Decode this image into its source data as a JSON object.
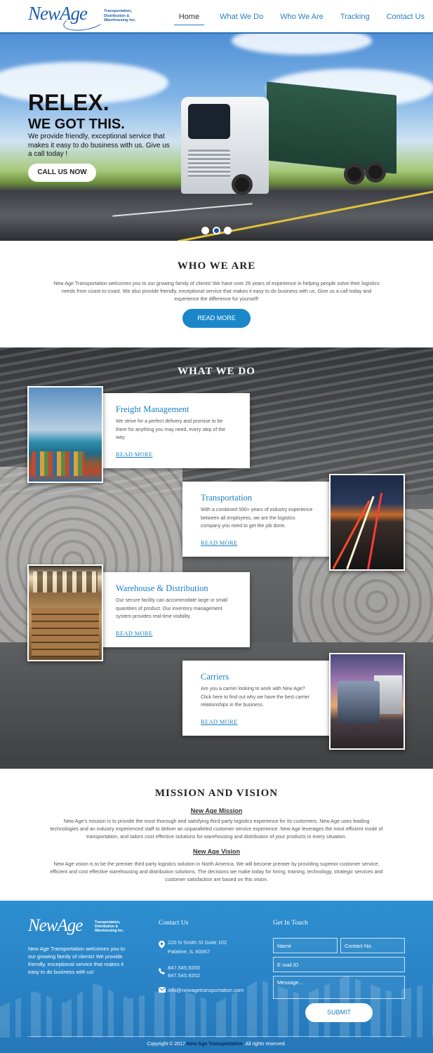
{
  "header": {
    "logo_word": "NewAge",
    "logo_tagline": "Transportation, Distribution & Warehousing Inc.",
    "nav": [
      "Home",
      "What We Do",
      "Who We Are",
      "Tracking",
      "Contact Us"
    ],
    "active_nav": "Home"
  },
  "hero": {
    "title": "RELEX.",
    "subtitle": "WE GOT THIS.",
    "text": "We provide friendly, exceptional service that makes it easy to do business with us. Give us a call today !",
    "button": "CALL US NOW",
    "slides": 3,
    "active_slide": 2
  },
  "who": {
    "title": "WHO WE ARE",
    "text": "New Age Transportation welcomes you to our growing family of clients! We have over 26 years of experience in helping people solve their logistics needs from coast-to-coast. We also provide friendly, exceptional service that makes it easy to do business with us. Give us a call today and experience the difference for yourself!",
    "button": "READ MORE"
  },
  "what": {
    "title": "WHAT WE DO",
    "cards": [
      {
        "title": "Freight Management",
        "text": "We strive for a perfect delivery and promise to be there for anything you may need, every step of the way.",
        "link": "READ MORE"
      },
      {
        "title": "Transportation",
        "text": "With a combined 500+ years of industry experience between all employees, we are the logistics company you need to get the job done.",
        "link": "READ MORE"
      },
      {
        "title": "Warehouse & Distribution",
        "text": "Our secure facility can accommodate large or small quantities of product. Our inventory management system provides real-time visibility.",
        "link": "READ MORE"
      },
      {
        "title": "Carriers",
        "text": "Are you a carrier looking to work with New Age? Click here to find out why we have the best carrier relationships in the business.",
        "link": "READ MORE"
      }
    ]
  },
  "mission": {
    "title": "MISSION AND VISION",
    "mission_heading": "New Age Mission",
    "mission_text": "New Age's mission is to provide the most thorough and satisfying third-party logistics experience for its customers. New Age uses leading technologies and an industry experienced staff to deliver an unparalleled customer service experience. New Age leverages the most efficient mode of transportation, and tailors cost effective solutions for warehousing and distribution of your products in every situation.",
    "vision_heading": "New Age Vision",
    "vision_text": "New Age vision is to be the premier third party logistics solution in North America. We will become premier by providing superior customer service, efficient and cost effective warehousing and distribution solutions. The decisions we make today for hiring, training, technology, strategic services and customer satisfaction are based on this vision."
  },
  "footer": {
    "logo_word": "NewAge",
    "logo_tagline": "Transportation, Distribution & Warehousing Inc.",
    "about": "New Age Transportation welcomes you to our growing family of clients! We  provide friendly, exceptional service that makes it easy to do business with us!",
    "contact_heading": "Contact Us",
    "address_line1": "220 N Smith St Suite 102",
    "address_line2": "Palatine, IL 60067",
    "phone1": "847.545.9200",
    "phone2": "847.545.9202",
    "email": "info@newagetransportation.com",
    "form_heading": "Get In Touch",
    "form": {
      "name_placeholder": "Name",
      "contact_placeholder": "Contact No.",
      "email_placeholder": "E mail ID",
      "message_placeholder": "Message...",
      "submit": "SUBMIT"
    },
    "copyright_prefix": "Copyright © 2017",
    "copyright_brand": "New Age Transportation",
    "copyright_suffix": ". All rights reserved."
  }
}
